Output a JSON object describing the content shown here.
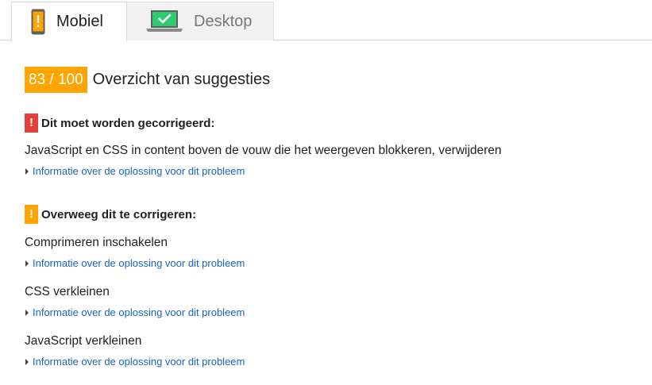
{
  "tabs": [
    {
      "label": "Mobiel",
      "icon": "phone-warning-icon",
      "active": true
    },
    {
      "label": "Desktop",
      "icon": "laptop-check-icon",
      "active": false
    }
  ],
  "score": {
    "badge": "83 / 100",
    "title": "Overzicht van suggesties",
    "color": "#ffa400"
  },
  "sections": [
    {
      "flag": "!",
      "flag_color": "#e0423b",
      "title": "Dit moet worden gecorrigeerd:",
      "rules": [
        {
          "title": "JavaScript en CSS in content boven de vouw die het weergeven blokkeren, verwijderen",
          "link": "Informatie over de oplossing voor dit probleem"
        }
      ]
    },
    {
      "flag": "!",
      "flag_color": "#ffa400",
      "title": "Overweeg dit te corrigeren:",
      "rules": [
        {
          "title": "Comprimeren inschakelen",
          "link": "Informatie over de oplossing voor dit probleem"
        },
        {
          "title": "CSS verkleinen",
          "link": "Informatie over de oplossing voor dit probleem"
        },
        {
          "title": "JavaScript verkleinen",
          "link": "Informatie over de oplossing voor dit probleem"
        }
      ]
    }
  ],
  "colors": {
    "link": "#1565c0",
    "text": "#212121"
  }
}
